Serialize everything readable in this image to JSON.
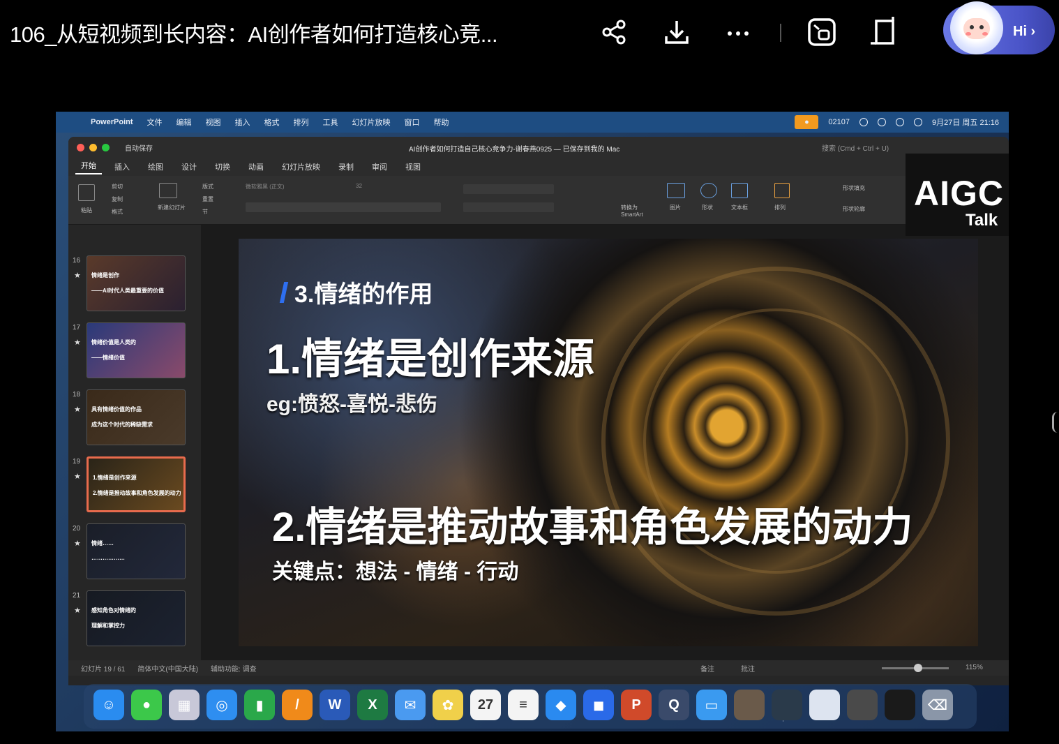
{
  "player": {
    "title": "106_从短视频到长内容：AI创作者如何打造核心竞...",
    "actions": [
      {
        "name": "share-icon",
        "glyph": "⟨"
      },
      {
        "name": "download-icon",
        "glyph": "↓"
      },
      {
        "name": "more-icon",
        "glyph": "···"
      },
      {
        "name": "screenshot-icon",
        "glyph": "⧉"
      },
      {
        "name": "crop-icon",
        "glyph": "⊏"
      }
    ],
    "assistant_label": "Hi ›"
  },
  "mac": {
    "apple_glyph": "",
    "menubar": [
      "PowerPoint",
      "文件",
      "编辑",
      "视图",
      "插入",
      "格式",
      "排列",
      "工具",
      "幻灯片放映",
      "窗口",
      "帮助"
    ],
    "timer": "02107",
    "datetime": "9月27日 周五 21:16"
  },
  "ppt": {
    "autosave": "自动保存",
    "doc_title": "AI创作者如何打造自己核心竞争力-谢春燕0925 — 已保存到我的 Mac",
    "search_placeholder": "搜索 (Cmd + Ctrl + U)",
    "tabs": [
      "开始",
      "插入",
      "绘图",
      "设计",
      "切换",
      "动画",
      "幻灯片放映",
      "录制",
      "审阅",
      "视图"
    ],
    "ribbon_labels": [
      "粘贴",
      "剪切",
      "复制",
      "格式",
      "新建幻灯片",
      "版式",
      "重置",
      "节",
      "转换为SmartArt",
      "图片",
      "形状",
      "文本框",
      "排列",
      "快速样式",
      "形状填充",
      "形状轮廓"
    ],
    "font_name": "微软雅黑 (正文)",
    "font_size": "32",
    "status_left": "幻灯片 19 / 61",
    "status_lang": "简体中文(中国大陆)",
    "status_access": "辅助功能: 调查",
    "status_notes": "备注",
    "status_comments": "批注",
    "zoom": "115%"
  },
  "logo": {
    "big": "AIGC",
    "small": "Talk"
  },
  "thumbnails": [
    {
      "num": "16",
      "lines": [
        "情绪是创作",
        "——AI时代人类最重要的价值"
      ],
      "colors": [
        "#5a3a2a",
        "#2a2030"
      ],
      "selected": false
    },
    {
      "num": "17",
      "lines": [
        "情绪价值是人类的",
        "——情绪价值"
      ],
      "colors": [
        "#2a3a7a",
        "#8a4a6a"
      ],
      "selected": false
    },
    {
      "num": "18",
      "lines": [
        "具有情绪价值的作品",
        "成为这个时代的稀缺需求"
      ],
      "colors": [
        "#3a2a1a",
        "#4a3a2a"
      ],
      "selected": false
    },
    {
      "num": "19",
      "lines": [
        "1.情绪是创作来源",
        "2.情绪是推动故事和角色发展的动力"
      ],
      "colors": [
        "#2a2418",
        "#6a4a20"
      ],
      "selected": true
    },
    {
      "num": "20",
      "lines": [
        "情绪……",
        "………………"
      ],
      "colors": [
        "#1a1e28",
        "#22283a"
      ],
      "selected": false
    },
    {
      "num": "21",
      "lines": [
        "感知角色对情绪的",
        "理解和掌控力"
      ],
      "colors": [
        "#161a22",
        "#1c2230"
      ],
      "selected": false
    }
  ],
  "slide": {
    "heading": "3.情绪的作用",
    "point1": "1.情绪是创作来源",
    "eg": "eg:愤怒-喜悦-悲伤",
    "point2": "2.情绪是推动故事和角色发展的动力",
    "key": "关键点：想法 - 情绪 - 行动"
  },
  "dock": [
    {
      "name": "finder",
      "color": "#2a8cf0",
      "glyph": "☺"
    },
    {
      "name": "messages",
      "color": "#3cc84a",
      "glyph": "●"
    },
    {
      "name": "launchpad",
      "color": "#c8c8d8",
      "glyph": "▦"
    },
    {
      "name": "safari",
      "color": "#2e8ef0",
      "glyph": "◎"
    },
    {
      "name": "numbers",
      "color": "#2aa84a",
      "glyph": "▮"
    },
    {
      "name": "pages",
      "color": "#f08a1a",
      "glyph": "/"
    },
    {
      "name": "word",
      "color": "#2a5ab8",
      "glyph": "W"
    },
    {
      "name": "excel",
      "color": "#1e7a42",
      "glyph": "X"
    },
    {
      "name": "mail",
      "color": "#4a9af0",
      "glyph": "✉"
    },
    {
      "name": "photos",
      "color": "#f0d04a",
      "glyph": "✿"
    },
    {
      "name": "calendar",
      "color": "#f4f4f4",
      "glyph": "27"
    },
    {
      "name": "reminders",
      "color": "#f4f4f4",
      "glyph": "≡"
    },
    {
      "name": "qq",
      "color": "#2a8af0",
      "glyph": "◆"
    },
    {
      "name": "meeting",
      "color": "#2a6ae8",
      "glyph": "◼"
    },
    {
      "name": "powerpoint",
      "color": "#d04a2a",
      "glyph": "P"
    },
    {
      "name": "quicktime",
      "color": "#3a4a6a",
      "glyph": "Q"
    },
    {
      "name": "preview",
      "color": "#3a9af0",
      "glyph": "▭"
    },
    {
      "name": "window-1",
      "color": "#6a5a4a",
      "glyph": ""
    },
    {
      "name": "window-2",
      "color": "#2a3a4a",
      "glyph": ""
    },
    {
      "name": "window-3",
      "color": "#dde4f0",
      "glyph": ""
    },
    {
      "name": "window-4",
      "color": "#4a4a4a",
      "glyph": ""
    },
    {
      "name": "window-5",
      "color": "#1a1a1a",
      "glyph": ""
    },
    {
      "name": "trash",
      "color": "#8a96a8",
      "glyph": "⌫"
    }
  ]
}
